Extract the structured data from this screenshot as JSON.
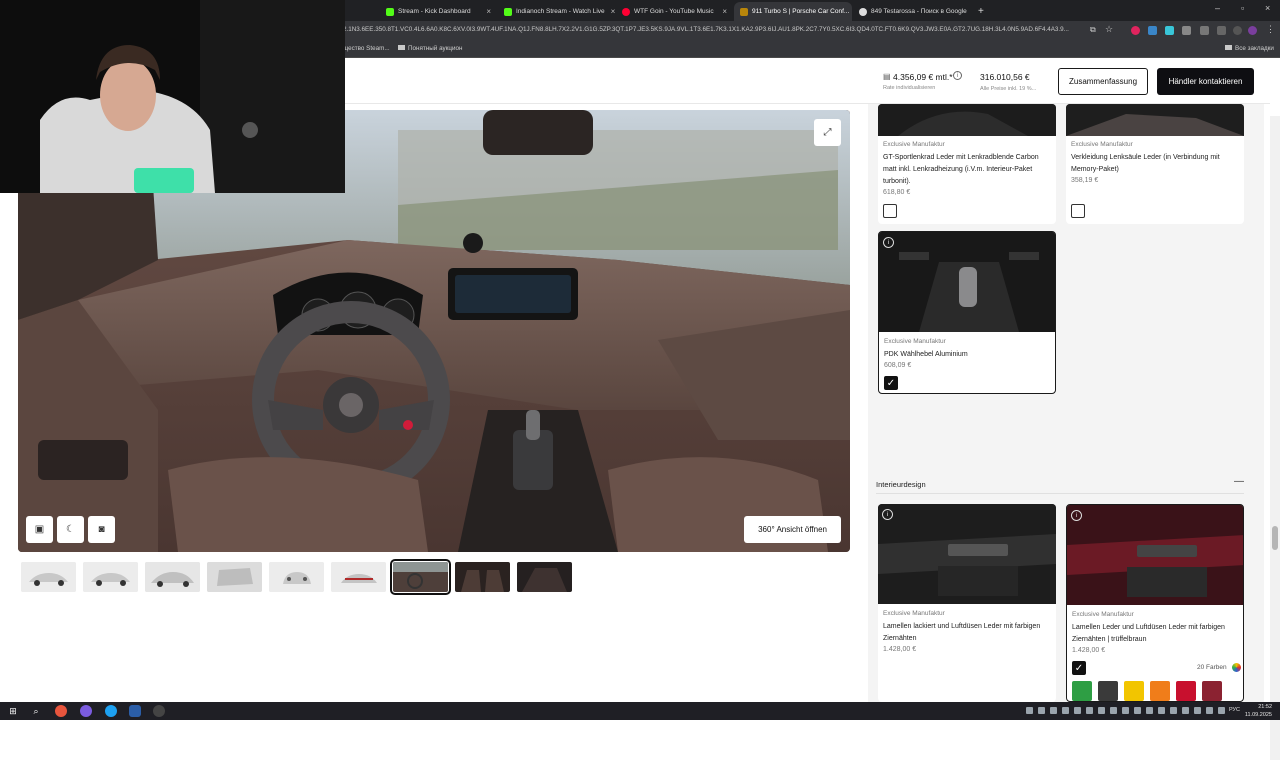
{
  "browser": {
    "tabs": [
      {
        "label": "Stream - Kick Dashboard",
        "color": "#53fc18"
      },
      {
        "label": "Indianoch Stream - Watch Live",
        "color": "#53fc18"
      },
      {
        "label": "WTF Goin - YouTube Music",
        "color": "#ff0033"
      },
      {
        "label": "911 Turbo S | Porsche Car Conf...",
        "color": "#b8860b"
      },
      {
        "label": "849 Testarossa - Поиск в Google",
        "color": "#cccccc"
      }
    ],
    "new_tab": "+",
    "url": "2.1N3.6EE.350.8T1.VC0.4L6.6A0.K8C.6XV.0I3.9WT.4UF.1NA.Q1J.FN8.8LH.7X2.2V1.G1G.5ZP.3QT.1P7.JE3.5KS.9JA.9VL.1T3.6E1.7K3.1X1.KA2.9P3.6IJ.AU1.8PK.2C7.7Y0.5XC.6I3.QD4.0TC.FT0.6K9.QV3.JW3.E0A.GT2.7UG.18H.3L4.0N5.9AD.6F4.4A3.9...",
    "bookmarks": [
      "щество Steam...",
      "Понятный аукцион"
    ],
    "all_bookmarks": "Все закладки"
  },
  "header": {
    "rate_price": "4.356,09 € mtl.*",
    "rate_label": "Rate individualisieren",
    "total_price": "316.010,56 €",
    "total_label": "Alle Preise inkl. 19 %...",
    "summary_button": "Zusammenfassung",
    "contact_button": "Händler kontaktieren"
  },
  "viewer": {
    "open_360": "360° Ansicht öffnen",
    "thumbnail_count": 9,
    "selected_thumbnail": 7
  },
  "options": [
    {
      "tag": "Exclusive Manufaktur",
      "title": "GT-Sportlenkrad Leder mit Lenkradblende Carbon matt inkl. Lenkradheizung (i.V.m. Interieur-Paket turbonit).",
      "price": "618,80 €",
      "checked": false
    },
    {
      "tag": "Exclusive Manufaktur",
      "title": "Verkleidung Lenksäule Leder (in Verbindung mit Memory-Paket)",
      "price": "358,19 €",
      "checked": false
    },
    {
      "tag": "Exclusive Manufaktur",
      "title": "PDK Wählhebel Aluminium",
      "price": "608,09 €",
      "checked": true
    }
  ],
  "interior_section": {
    "title": "Interieurdesign",
    "collapse": "—",
    "cards": [
      {
        "tag": "Exclusive Manufaktur",
        "title": "Lamellen lackiert und Luftdüsen Leder mit farbigen Ziernähten",
        "price": "1.428,00 €"
      },
      {
        "tag": "Exclusive Manufaktur",
        "title": "Lamellen Leder und Luftdüsen Leder mit farbigen Ziernähten | trüffelbraun",
        "price": "1.428,00 €",
        "checked": true,
        "colors_label": "20 Farben"
      }
    ],
    "swatches": [
      "#2e9e44",
      "#3a3a3a",
      "#f2c500",
      "#f07d1a",
      "#c8102e",
      "#8b2231",
      "#19a6d9",
      "#2c4a3e",
      "#1563a8",
      "#4a4f5c",
      "#b3006b",
      "#d0d0d0",
      "#cfcfcf",
      "#5a5a5a",
      "#4b4b4b",
      "#111111",
      "#f4f4f4",
      "#bdbab2"
    ]
  },
  "taskbar": {
    "time": "21:52",
    "date": "11.09.2025",
    "lang": "РУС"
  }
}
